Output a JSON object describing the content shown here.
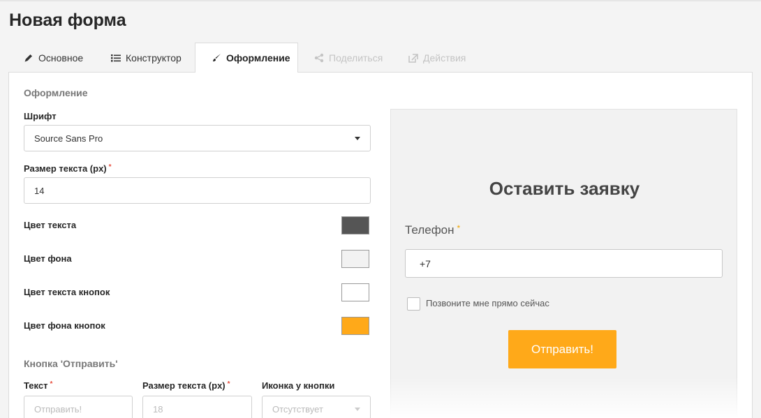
{
  "page": {
    "title": "Новая форма"
  },
  "tabs": [
    {
      "label": "Основное",
      "icon": "pencil-icon"
    },
    {
      "label": "Конструктор",
      "icon": "list-icon"
    },
    {
      "label": "Оформление",
      "icon": "brush-icon"
    },
    {
      "label": "Поделиться",
      "icon": "share-icon"
    },
    {
      "label": "Действия",
      "icon": "external-link-icon"
    }
  ],
  "design": {
    "section_title": "Оформление",
    "font_label": "Шрифт",
    "font_value": "Source Sans Pro",
    "text_size_label": "Размер текста (px)",
    "text_size_value": "14",
    "text_color_label": "Цвет текста",
    "text_color": "#555555",
    "bg_color_label": "Цвет фона",
    "bg_color": "#f2f2f2",
    "btn_text_color_label": "Цвет текста кнопок",
    "btn_text_color": "#ffffff",
    "btn_bg_color_label": "Цвет фона кнопок",
    "btn_bg_color": "#ffa919"
  },
  "submit_button_settings": {
    "section_title": "Кнопка 'Отправить'",
    "text_label": "Текст",
    "text_placeholder": "Отправить!",
    "size_label": "Размер текста (px)",
    "size_placeholder": "18",
    "icon_label": "Иконка у кнопки",
    "icon_value": "Отсутствует"
  },
  "preview": {
    "title": "Оставить заявку",
    "phone_label": "Телефон",
    "phone_value": "+7",
    "callback_label": "Позвоните мне прямо сейчас",
    "submit_label": "Отправить!",
    "required_mark": "*"
  }
}
